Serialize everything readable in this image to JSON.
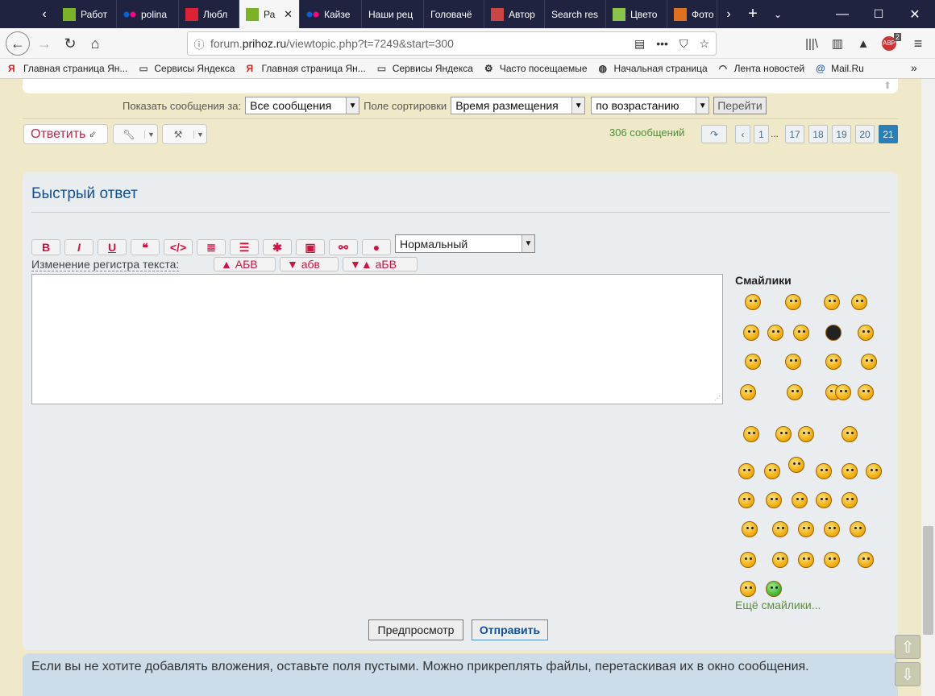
{
  "browser": {
    "tabs": [
      {
        "label": "Работ",
        "icon": "green-square-icon"
      },
      {
        "label": "polina",
        "icon": "flickr-icon"
      },
      {
        "label": "Любл",
        "icon": "heart-site-icon"
      },
      {
        "label": "Ра",
        "icon": "green-square-icon",
        "active": true
      },
      {
        "label": "Кайзе",
        "icon": "flickr-icon"
      },
      {
        "label": "Наши рец",
        "icon": ""
      },
      {
        "label": "Головачё",
        "icon": ""
      },
      {
        "label": "Автор",
        "icon": "book-icon"
      },
      {
        "label": "Search res",
        "icon": ""
      },
      {
        "label": "Цвето",
        "icon": "flower-icon"
      },
      {
        "label": "Фото",
        "icon": "photo-site-icon"
      }
    ],
    "url_prefix": "forum.",
    "url_host": "prihoz.ru",
    "url_path": "/viewtopic.php?t=7249&start=300",
    "bookmarks": [
      {
        "label": "Главная страница Ян...",
        "icon": "yandex-icon"
      },
      {
        "label": "Сервисы Яндекса",
        "icon": "folder-icon"
      },
      {
        "label": "Главная страница Ян...",
        "icon": "yandex-icon"
      },
      {
        "label": "Сервисы Яндекса",
        "icon": "folder-icon"
      },
      {
        "label": "Часто посещаемые",
        "icon": "gear-icon"
      },
      {
        "label": "Начальная страница",
        "icon": "globe-icon"
      },
      {
        "label": "Лента новостей",
        "icon": "rss-icon"
      },
      {
        "label": "Mail.Ru",
        "icon": "at-icon"
      }
    ],
    "badge_count": "2"
  },
  "sortbar": {
    "show_label": "Показать сообщения за:",
    "show_value": "Все сообщения",
    "sort_label": "Поле сортировки",
    "sort_value": "Время размещения",
    "order_value": "по возрастанию",
    "go_label": "Перейти"
  },
  "actions": {
    "reply_label": "Ответить"
  },
  "pagination": {
    "count_label": "306 сообщений",
    "pages": [
      "1",
      "...",
      "17",
      "18",
      "19",
      "20",
      "21"
    ],
    "current": "21"
  },
  "quick_reply": {
    "title": "Быстрый ответ",
    "format_buttons": [
      "B",
      "I",
      "U",
      "❝",
      "</>",
      "≣",
      "☰",
      "✱",
      "▣",
      "⚯",
      "●"
    ],
    "font_size_value": "Нормальный",
    "case_label": "Изменение регистра текста:",
    "case_buttons": [
      "▲ АБВ",
      "▼ абв",
      "▼▲ аБВ"
    ],
    "smilies_title": "Смайлики",
    "more_smilies": "Ещё смайлики...",
    "preview_label": "Предпросмотр",
    "submit_label": "Отправить"
  },
  "attachments": {
    "info_text": "Если вы не хотите добавлять вложения, оставьте поля пустыми. Можно прикреплять файлы, перетаскивая их в окно сообщения."
  },
  "colors": {
    "page_bg": "#efe8c9",
    "accent_red": "#bc2a4d",
    "title_blue": "#115098",
    "green": "#4f8e3a"
  }
}
